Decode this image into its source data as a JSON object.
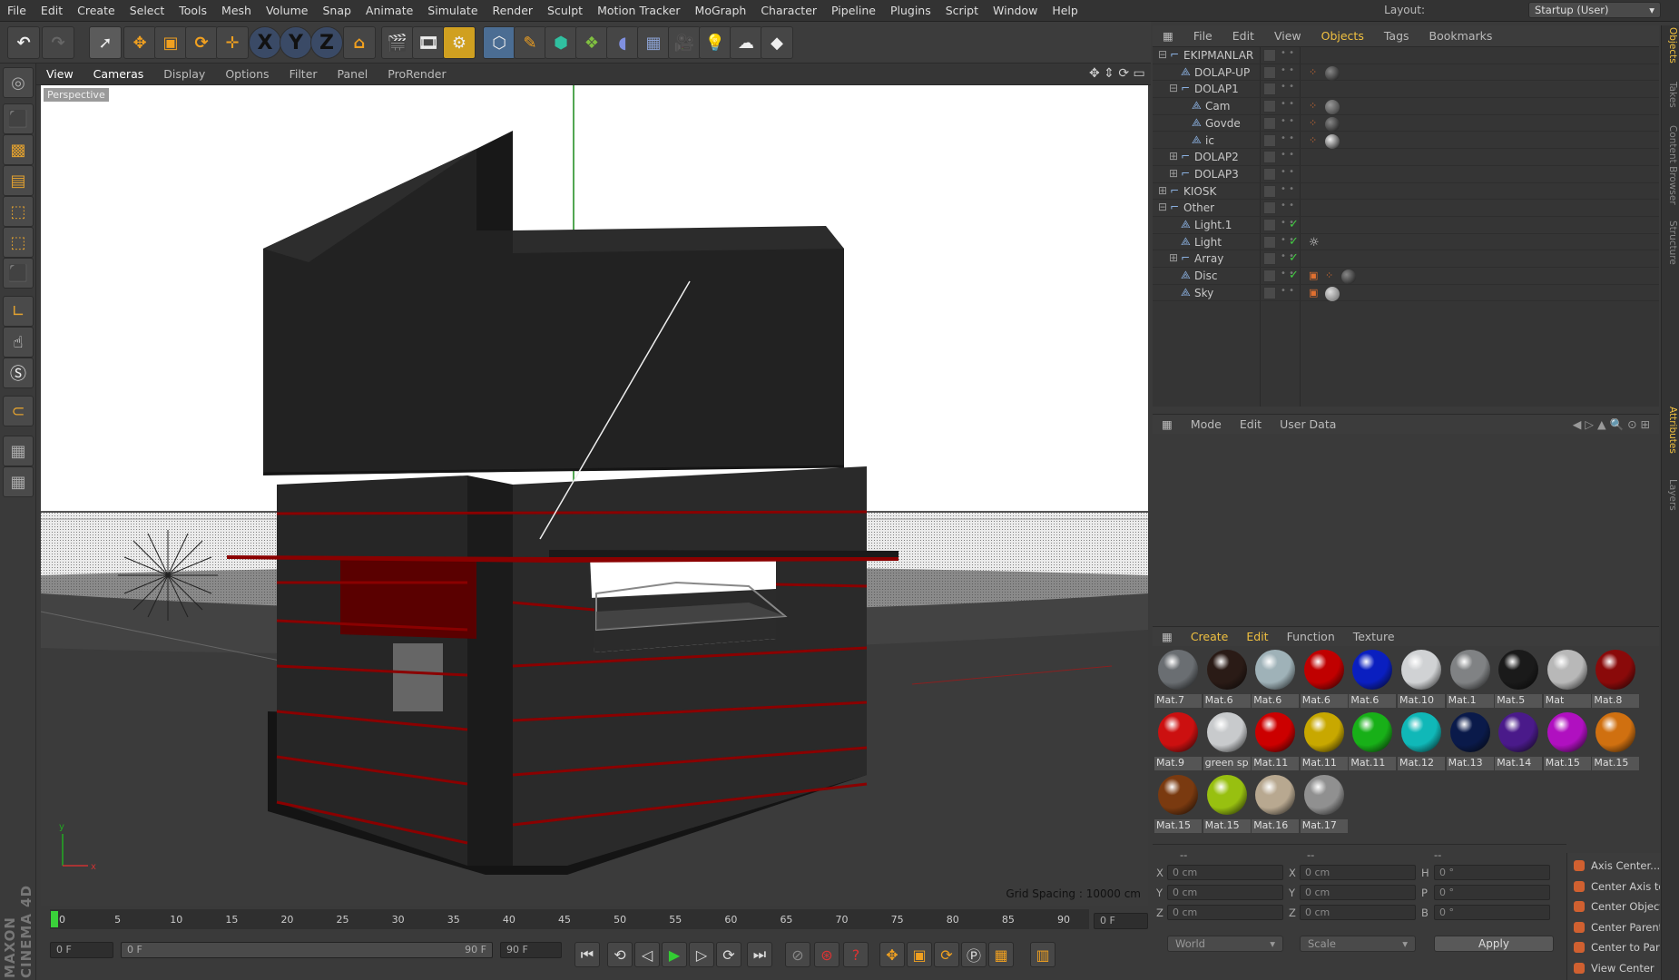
{
  "menubar": {
    "items": [
      "File",
      "Edit",
      "Create",
      "Select",
      "Tools",
      "Mesh",
      "Volume",
      "Snap",
      "Animate",
      "Simulate",
      "Render",
      "Sculpt",
      "Motion Tracker",
      "MoGraph",
      "Character",
      "Pipeline",
      "Plugins",
      "Script",
      "Window",
      "Help"
    ],
    "layout_label": "Layout:",
    "layout_value": "Startup (User)"
  },
  "viewport": {
    "menu": [
      "View",
      "Cameras",
      "Display",
      "Options",
      "Filter",
      "Panel",
      "ProRender"
    ],
    "camera_label": "Perspective",
    "grid_spacing": "Grid Spacing : 10000 cm"
  },
  "timeline": {
    "ticks": [
      "0",
      "5",
      "10",
      "15",
      "20",
      "25",
      "30",
      "35",
      "40",
      "45",
      "50",
      "55",
      "60",
      "65",
      "70",
      "75",
      "80",
      "85",
      "90"
    ],
    "current_frame": "0 F",
    "start_frame": "0 F",
    "range_start": "0 F",
    "range_end": "90 F",
    "end_frame": "90 F"
  },
  "object_manager": {
    "menu": [
      "File",
      "Edit",
      "View",
      "Objects",
      "Tags",
      "Bookmarks"
    ],
    "objects": [
      {
        "name": "EKIPMANLAR",
        "indent": 0,
        "expander": "minus",
        "tags": []
      },
      {
        "name": "DOLAP-UP",
        "indent": 1,
        "expander": "",
        "tags": [
          "dots",
          "sphere"
        ]
      },
      {
        "name": "DOLAP1",
        "indent": 1,
        "expander": "minus",
        "tags": []
      },
      {
        "name": "Cam",
        "indent": 2,
        "expander": "",
        "tags": [
          "dots",
          "glass"
        ]
      },
      {
        "name": "Govde",
        "indent": 2,
        "expander": "",
        "tags": [
          "dots",
          "sphere"
        ]
      },
      {
        "name": "ic",
        "indent": 2,
        "expander": "",
        "tags": [
          "dots",
          "chrome"
        ]
      },
      {
        "name": "DOLAP2",
        "indent": 1,
        "expander": "plus",
        "tags": []
      },
      {
        "name": "DOLAP3",
        "indent": 1,
        "expander": "plus",
        "tags": []
      },
      {
        "name": "KIOSK",
        "indent": 0,
        "expander": "plus",
        "tags": []
      },
      {
        "name": "Other",
        "indent": 0,
        "expander": "minus",
        "tags": []
      },
      {
        "name": "Light.1",
        "indent": 1,
        "expander": "",
        "tags": [],
        "check": true
      },
      {
        "name": "Light",
        "indent": 1,
        "expander": "",
        "tags": [
          "sun"
        ],
        "check": true
      },
      {
        "name": "Array",
        "indent": 1,
        "expander": "plus",
        "tags": [],
        "check": true
      },
      {
        "name": "Disc",
        "indent": 1,
        "expander": "",
        "tags": [
          "render",
          "dots",
          "sphere"
        ],
        "check": true
      },
      {
        "name": "Sky",
        "indent": 1,
        "expander": "",
        "tags": [
          "render",
          "grey"
        ]
      }
    ]
  },
  "attributes": {
    "menu": [
      "Mode",
      "Edit",
      "User Data"
    ]
  },
  "materials": {
    "menu": [
      "Create",
      "Edit",
      "Function",
      "Texture"
    ],
    "items": [
      {
        "name": "Mat.7",
        "color": "#6a6e72"
      },
      {
        "name": "Mat.6",
        "color": "#2a1b16"
      },
      {
        "name": "Mat.6",
        "color": "#9fb2b8"
      },
      {
        "name": "Mat.6",
        "color": "#c00000"
      },
      {
        "name": "Mat.6",
        "color": "#0a1fc0"
      },
      {
        "name": "Mat.10",
        "color": "#d0d2d4"
      },
      {
        "name": "Mat.1",
        "color": "#808284"
      },
      {
        "name": "Mat.5",
        "color": "#1a1a1a"
      },
      {
        "name": "Mat",
        "color": "#b8b8b8"
      },
      {
        "name": "Mat.8",
        "color": "#8a0a0a"
      },
      {
        "name": "Mat.9",
        "color": "#cc1010"
      },
      {
        "name": "green sp",
        "color": "#c8cacc"
      },
      {
        "name": "Mat.11",
        "color": "#cc0000"
      },
      {
        "name": "Mat.11",
        "color": "#c8a800"
      },
      {
        "name": "Mat.11",
        "color": "#18b018"
      },
      {
        "name": "Mat.12",
        "color": "#10b8b8"
      },
      {
        "name": "Mat.13",
        "color": "#0a1a4a"
      },
      {
        "name": "Mat.14",
        "color": "#4a1a8a"
      },
      {
        "name": "Mat.15",
        "color": "#b010c0"
      },
      {
        "name": "Mat.15",
        "color": "#d07010"
      },
      {
        "name": "Mat.15",
        "color": "#7a3a10"
      },
      {
        "name": "Mat.15",
        "color": "#98c010"
      },
      {
        "name": "Mat.16",
        "color": "#b8a890"
      },
      {
        "name": "Mat.17",
        "color": "#909090"
      }
    ]
  },
  "coordinates": {
    "headers": [
      "--",
      "--",
      "--"
    ],
    "pos": [
      {
        "axis": "X",
        "value": "0 cm"
      },
      {
        "axis": "Y",
        "value": "0 cm"
      },
      {
        "axis": "Z",
        "value": "0 cm"
      }
    ],
    "size": [
      {
        "axis": "X",
        "value": "0 cm"
      },
      {
        "axis": "Y",
        "value": "0 cm"
      },
      {
        "axis": "Z",
        "value": "0 cm"
      }
    ],
    "rot": [
      {
        "axis": "H",
        "value": "0 °"
      },
      {
        "axis": "P",
        "value": "0 °"
      },
      {
        "axis": "B",
        "value": "0 °"
      }
    ],
    "mode_world": "World",
    "mode_scale": "Scale",
    "apply": "Apply"
  },
  "axis_panel": {
    "items": [
      "Axis Center...",
      "Center Axis to",
      "Center Object to",
      "Center Parent to",
      "Center to Parent",
      "View Center"
    ]
  },
  "side_tabs": [
    "Objects",
    "Takes",
    "Content Browser",
    "Structure",
    "Attributes",
    "Layers"
  ],
  "branding": "MAXON CINEMA 4D"
}
